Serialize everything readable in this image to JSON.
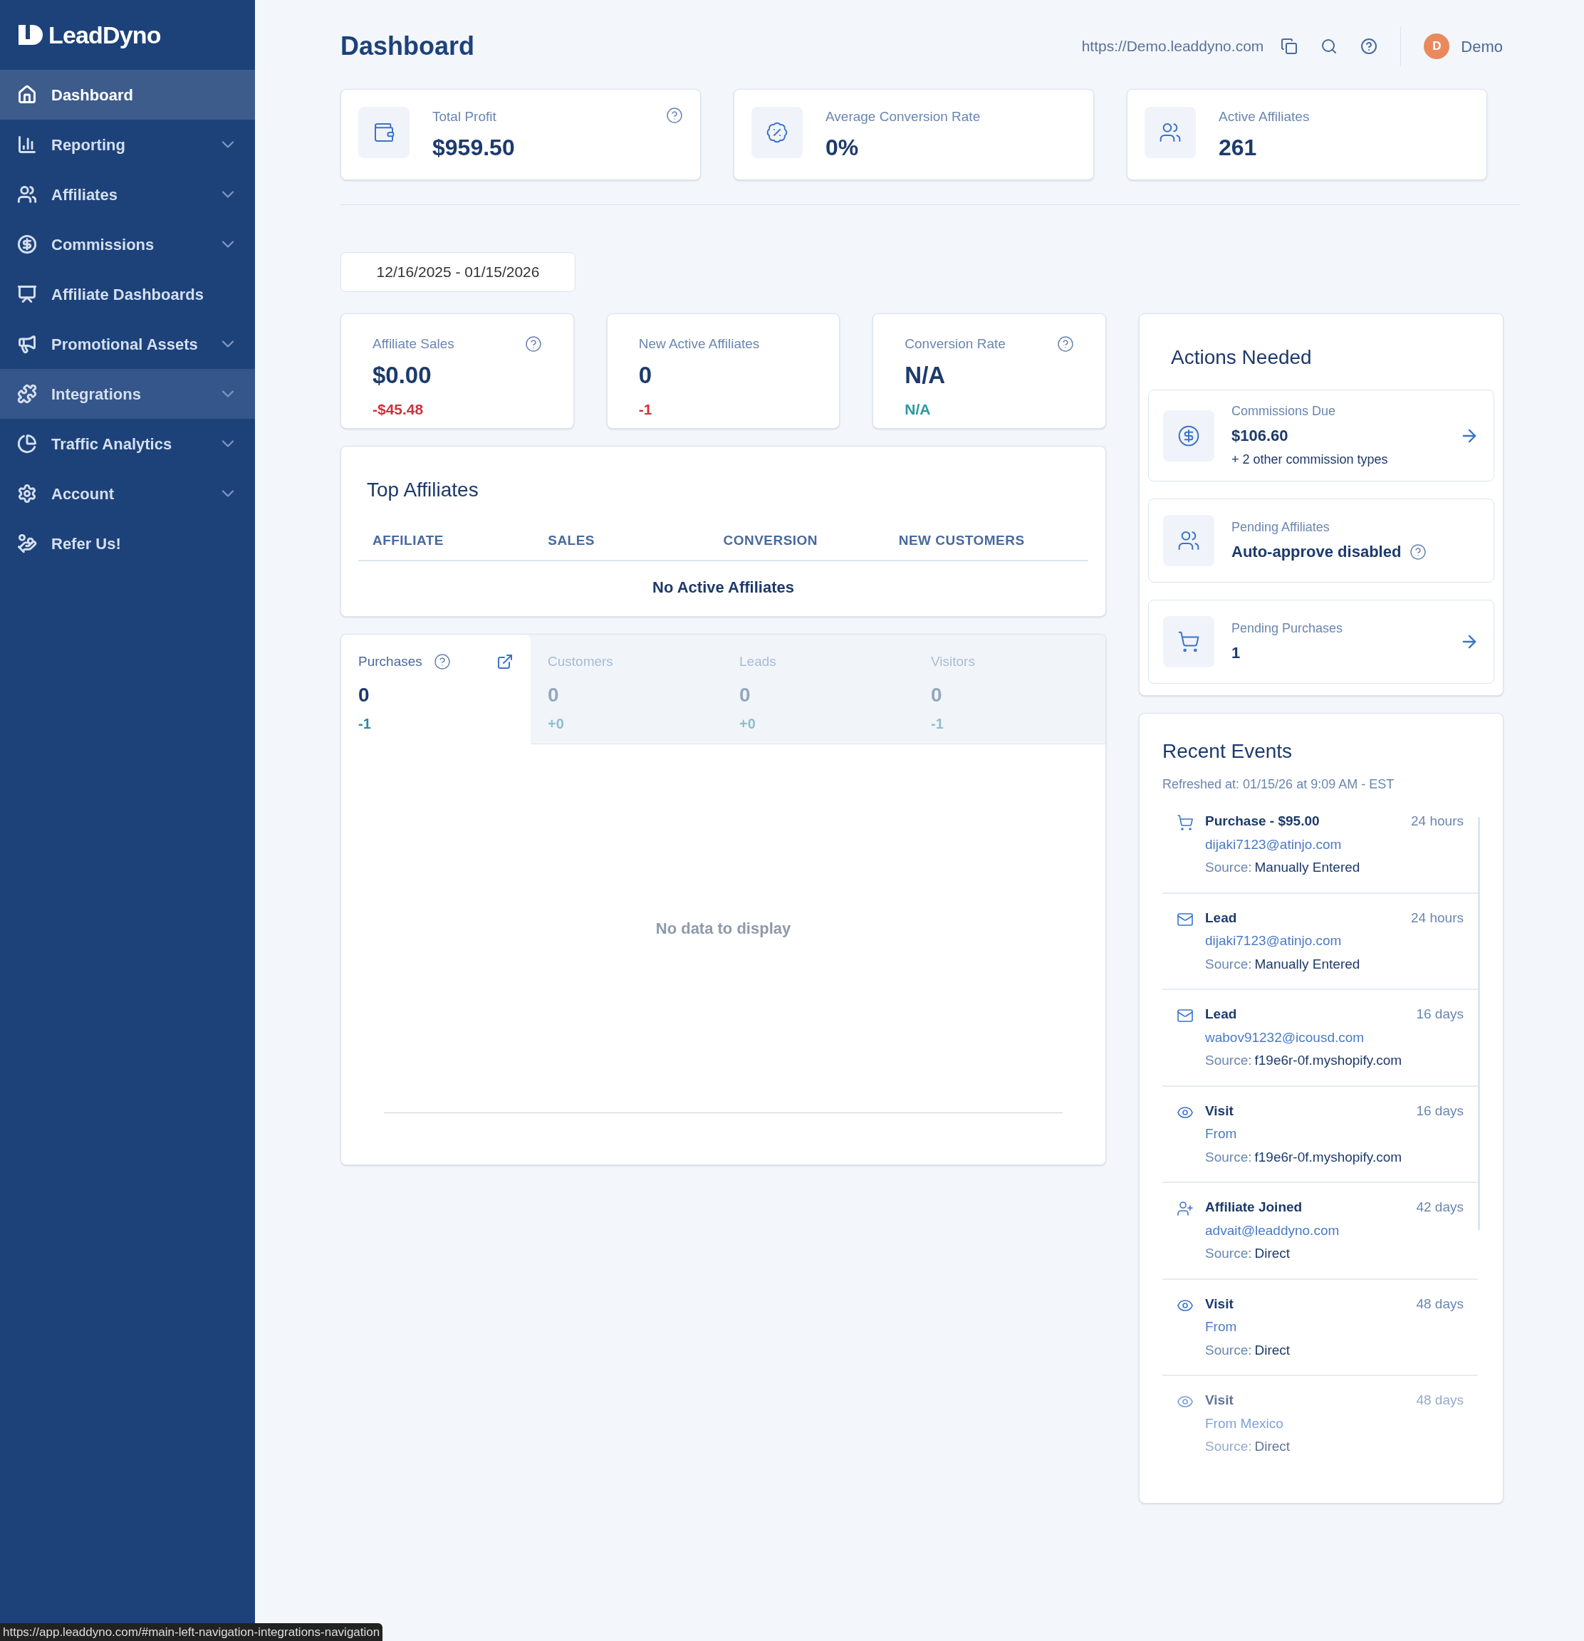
{
  "sidebar": {
    "logo": "LeadDyno",
    "items": [
      {
        "label": "Dashboard",
        "selected": true,
        "highlighted": false,
        "expandable": false
      },
      {
        "label": "Reporting",
        "selected": false,
        "highlighted": false,
        "expandable": true
      },
      {
        "label": "Affiliates",
        "selected": false,
        "highlighted": false,
        "expandable": true
      },
      {
        "label": "Commissions",
        "selected": false,
        "highlighted": false,
        "expandable": true
      },
      {
        "label": "Affiliate Dashboards",
        "selected": false,
        "highlighted": false,
        "expandable": false
      },
      {
        "label": "Promotional Assets",
        "selected": false,
        "highlighted": false,
        "expandable": true
      },
      {
        "label": "Integrations",
        "selected": false,
        "highlighted": true,
        "expandable": true
      },
      {
        "label": "Traffic Analytics",
        "selected": false,
        "highlighted": false,
        "expandable": true
      },
      {
        "label": "Account",
        "selected": false,
        "highlighted": false,
        "expandable": true
      },
      {
        "label": "Refer Us!",
        "selected": false,
        "highlighted": false,
        "expandable": false
      }
    ]
  },
  "header": {
    "title": "Dashboard",
    "url": "https://Demo.leaddyno.com",
    "user": {
      "initial": "D",
      "name": "Demo"
    }
  },
  "summary_cards": [
    {
      "label": "Total Profit",
      "value": "$959.50",
      "help": true
    },
    {
      "label": "Average Conversion Rate",
      "value": "0%",
      "help": false
    },
    {
      "label": "Active Affiliates",
      "value": "261",
      "help": false
    }
  ],
  "date_range": "12/16/2025 - 01/15/2026",
  "stat_cards": [
    {
      "label": "Affiliate Sales",
      "value": "$0.00",
      "change": "-$45.48",
      "kind": "negative",
      "help": true
    },
    {
      "label": "New Active Affiliates",
      "value": "0",
      "change": "-1",
      "kind": "negative",
      "help": false
    },
    {
      "label": "Conversion Rate",
      "value": "N/A",
      "change": "N/A",
      "kind": "neutral",
      "help": true
    }
  ],
  "top_affiliates": {
    "title": "Top Affiliates",
    "columns": [
      "AFFILIATE",
      "SALES",
      "CONVERSION",
      "NEW CUSTOMERS"
    ],
    "empty": "No Active Affiliates"
  },
  "metric_tabs": [
    {
      "label": "Purchases",
      "value": "0",
      "change": "-1",
      "selected": true,
      "help": true,
      "external": true
    },
    {
      "label": "Customers",
      "value": "0",
      "change": "+0",
      "selected": false,
      "help": false,
      "external": false
    },
    {
      "label": "Leads",
      "value": "0",
      "change": "+0",
      "selected": false,
      "help": false,
      "external": false
    },
    {
      "label": "Visitors",
      "value": "0",
      "change": "-1",
      "selected": false,
      "help": false,
      "external": false
    }
  ],
  "chart_empty": "No data to display",
  "actions_needed": {
    "title": "Actions Needed",
    "items": [
      {
        "label": "Commissions Due",
        "value": "$106.60",
        "note": "+ 2 other commission types",
        "help": false,
        "arrow": true
      },
      {
        "label": "Pending Affiliates",
        "value": "Auto-approve disabled",
        "help": true,
        "arrow": false
      },
      {
        "label": "Pending Purchases",
        "value": "1",
        "help": false,
        "arrow": true
      }
    ]
  },
  "recent_events": {
    "title": "Recent Events",
    "refreshed": "Refreshed at: 01/15/26 at 9:09 AM - EST",
    "items": [
      {
        "kind": "purchase",
        "title": "Purchase - $95.00",
        "time": "24 hours",
        "detail": "dijaki7123@atinjo.com",
        "source_label": "Source:",
        "source": "Manually Entered",
        "faded": false
      },
      {
        "kind": "lead",
        "title": "Lead",
        "time": "24 hours",
        "detail": "dijaki7123@atinjo.com",
        "source_label": "Source:",
        "source": "Manually Entered",
        "faded": false
      },
      {
        "kind": "lead",
        "title": "Lead",
        "time": "16 days",
        "detail": "wabov91232@icousd.com",
        "source_label": "Source:",
        "source": "f19e6r-0f.myshopify.com",
        "faded": false
      },
      {
        "kind": "visit",
        "title": "Visit",
        "time": "16 days",
        "detail": "From",
        "source_label": "Source:",
        "source": "f19e6r-0f.myshopify.com",
        "faded": false
      },
      {
        "kind": "affiliate",
        "title": "Affiliate Joined",
        "time": "42 days",
        "detail": "advait@leaddyno.com",
        "source_label": "Source:",
        "source": "Direct",
        "faded": false
      },
      {
        "kind": "visit",
        "title": "Visit",
        "time": "48 days",
        "detail": "From",
        "source_label": "Source:",
        "source": "Direct",
        "faded": false
      },
      {
        "kind": "visit",
        "title": "Visit",
        "time": "48 days",
        "detail": "From Mexico",
        "source_label": "Source:",
        "source": "Direct",
        "faded": true
      }
    ]
  },
  "status_bar": "https://app.leaddyno.com/#main-left-navigation-integrations-navigation"
}
